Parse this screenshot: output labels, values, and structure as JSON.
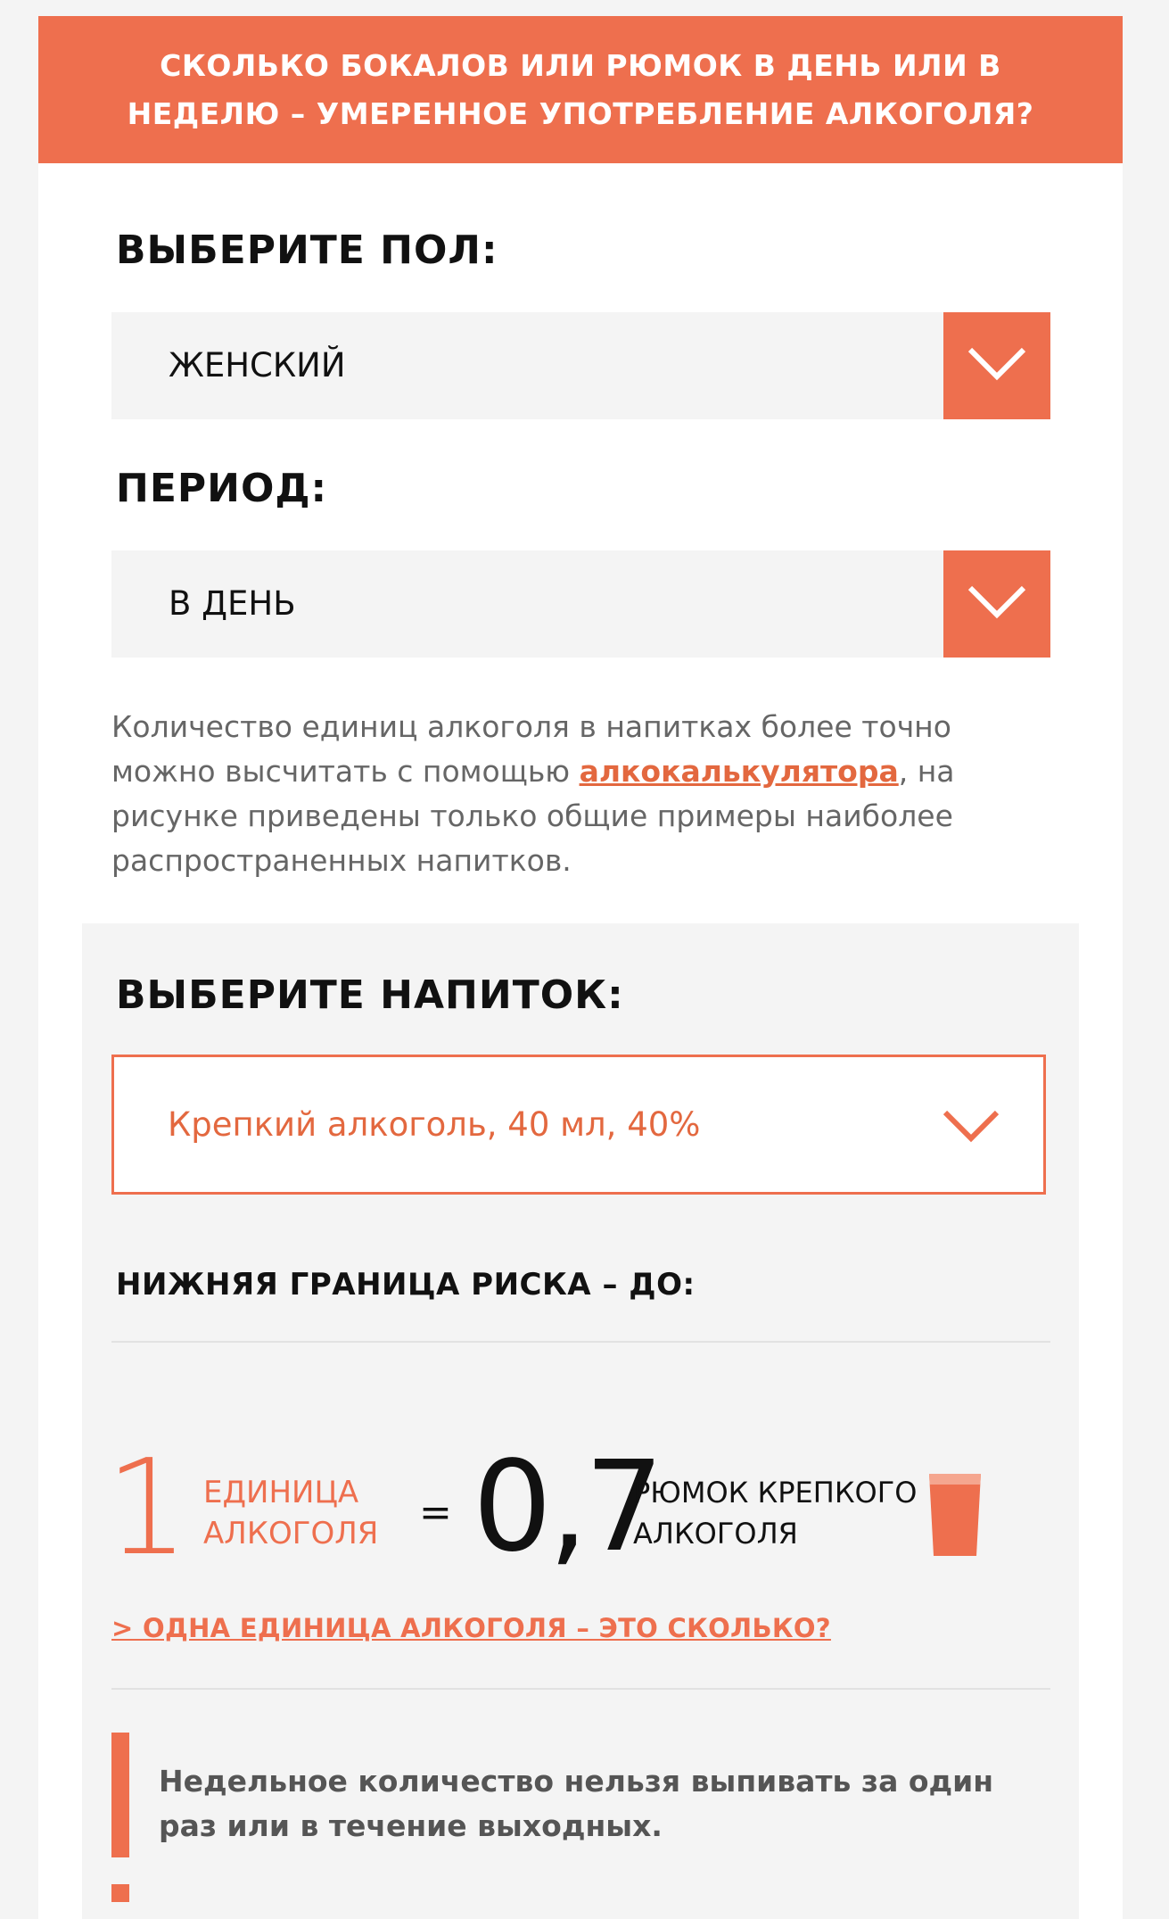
{
  "header": {
    "title": "СКОЛЬКО БОКАЛОВ ИЛИ РЮМОК В ДЕНЬ ИЛИ В НЕДЕЛЮ – УМЕРЕННОЕ УПОТРЕБЛЕНИЕ АЛКОГОЛЯ?"
  },
  "gender": {
    "label": "ВЫБЕРИТЕ ПОЛ:",
    "selected": "ЖЕНСКИЙ"
  },
  "period": {
    "label": "ПЕРИОД:",
    "selected": "В ДЕНЬ"
  },
  "info": {
    "text_before": "Количество единиц алкоголя в напитках более точно можно высчитать с помощью ",
    "link": "алкокалькулятора",
    "text_after": ", на рисунке приведены только общие примеры наиболее распространенных напитков."
  },
  "drink": {
    "label": "ВЫБЕРИТЕ НАПИТОК:",
    "selected": "Крепкий алкоголь, 40 мл, 40%"
  },
  "risk": {
    "title": "НИЖНЯЯ ГРАНИЦА РИСКА – ДО:",
    "units_value": "1",
    "units_label": "ЕДИНИЦА АЛКОГОЛЯ",
    "equals": "=",
    "amount": "0,7",
    "amount_label": "РЮМОК КРЕПКОГО АЛКОГОЛЯ",
    "glass_icon": "shot-glass-icon"
  },
  "unit_link": "> ОДНА ЕДИНИЦА АЛКОГОЛЯ – ЭТО СКОЛЬКО?",
  "warning": {
    "text": "Недельное количество нельзя выпивать за один раз или в течение выходных."
  },
  "colors": {
    "accent": "#ee6f4e",
    "panel": "#f4f4f4",
    "text": "#111111",
    "muted": "#666666"
  }
}
